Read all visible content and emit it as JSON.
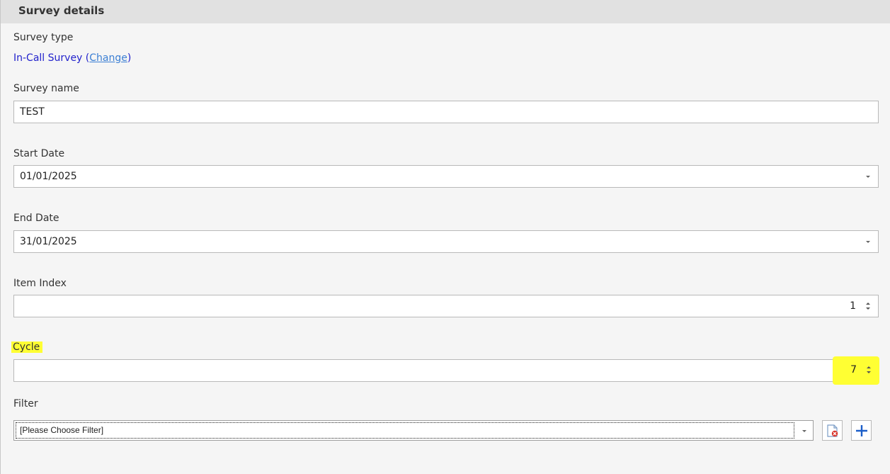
{
  "panel": {
    "title": "Survey details"
  },
  "survey_type": {
    "label": "Survey type",
    "value": "In-Call Survey",
    "open_paren": " (",
    "change_link": "Change",
    "close_paren": ")"
  },
  "survey_name": {
    "label": "Survey name",
    "value": "TEST"
  },
  "start_date": {
    "label": "Start Date",
    "value": "01/01/2025"
  },
  "end_date": {
    "label": "End Date",
    "value": "31/01/2025"
  },
  "item_index": {
    "label": "Item Index",
    "value": "1"
  },
  "cycle": {
    "label": "Cycle",
    "value": "7"
  },
  "filter": {
    "label": "Filter",
    "selected": "[Please Choose Filter]"
  },
  "icons": {
    "dropdown": "chevron-down-icon",
    "spinner": "spinner-arrows-icon",
    "clear_filter": "clear-filter-icon",
    "add_filter": "plus-icon"
  },
  "colors": {
    "highlight": "#ffff33",
    "link": "#3b7fd4",
    "survey_type_value": "#2222cc",
    "add_icon": "#1c5fc9",
    "clear_icon": "#d9342b"
  }
}
